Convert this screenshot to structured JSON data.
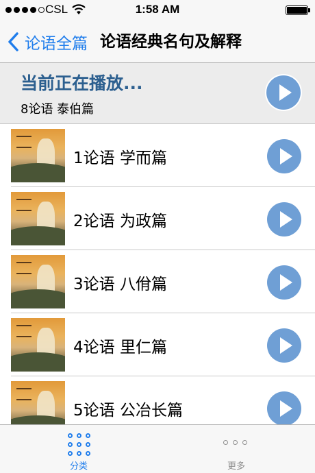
{
  "status_bar": {
    "carrier": "CSL",
    "time": "1:58 AM",
    "signal_bars": 4,
    "signal_total": 5,
    "battery_level": 1.0
  },
  "nav": {
    "back_label": "论语全篇",
    "title": "论语经典名句及解释"
  },
  "now_playing": {
    "label": "当前正在播放...",
    "track": "8论语 泰伯篇"
  },
  "list": [
    {
      "name": "1论语 学而篇",
      "thumb": "confucius-thumbnail"
    },
    {
      "name": "2论语 为政篇",
      "thumb": "confucius-thumbnail"
    },
    {
      "name": "3论语 八佾篇",
      "thumb": "confucius-thumbnail"
    },
    {
      "name": "4论语 里仁篇",
      "thumb": "confucius-thumbnail"
    },
    {
      "name": "5论语 公冶长篇",
      "thumb": "confucius-thumbnail"
    }
  ],
  "tabs": [
    {
      "label": "分类",
      "icon": "grid-icon",
      "selected": true
    },
    {
      "label": "更多",
      "icon": "more-icon",
      "selected": false
    }
  ],
  "colors": {
    "accent": "#1f7dec",
    "play_button": "#6f9fd5",
    "now_playing_label": "#2c5f8f"
  }
}
